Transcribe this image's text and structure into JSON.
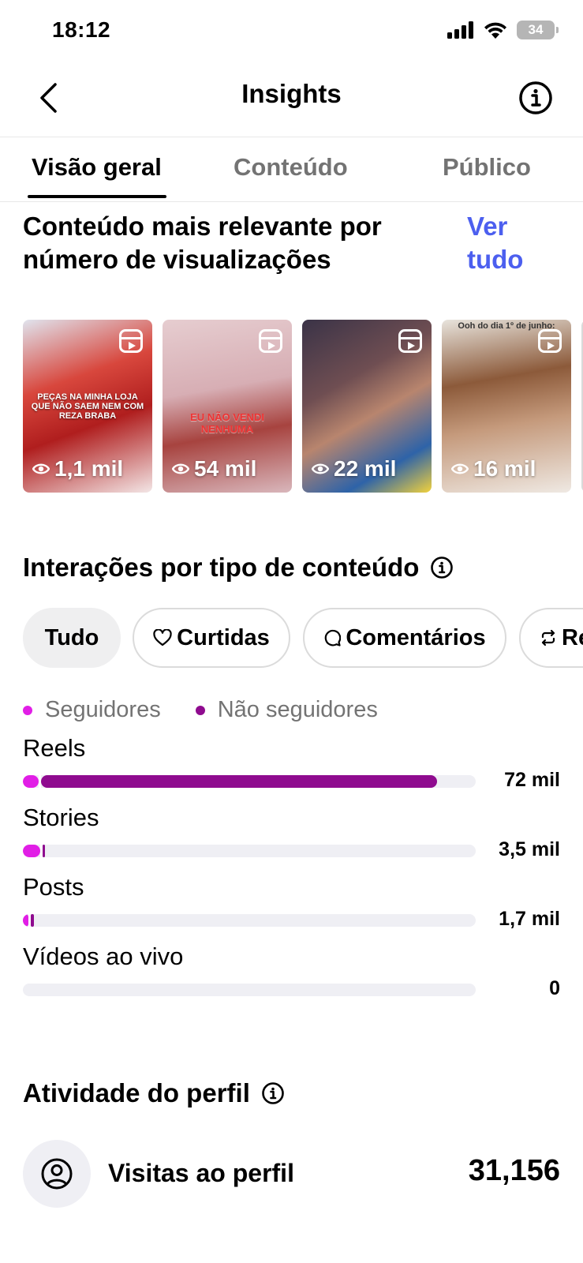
{
  "status_bar": {
    "time": "18:12",
    "battery": "34",
    "icons": [
      "signal-icon",
      "wifi-icon",
      "battery-icon"
    ]
  },
  "header": {
    "title": "Insights",
    "back_icon": "chevron-left-icon",
    "info_icon": "info-icon"
  },
  "tabs": [
    {
      "label": "Visão geral",
      "active": true
    },
    {
      "label": "Conteúdo",
      "active": false
    },
    {
      "label": "Público",
      "active": false
    }
  ],
  "top_content": {
    "title": "Conteúdo mais relevante por número de visualizações",
    "see_all": "Ver tudo",
    "items": [
      {
        "views": "1,1 mil",
        "overlay": "PEÇAS NA MINHA LOJA QUE NÃO SAEM NEM COM REZA BRABA",
        "type": "reel"
      },
      {
        "views": "54 mil",
        "overlay": "EU NÃO VENDI NENHUMA",
        "type": "reel"
      },
      {
        "views": "22 mil",
        "overlay": "",
        "type": "reel"
      },
      {
        "views": "16 mil",
        "overlay": "Ooh do dia 1º de junho:",
        "type": "reel"
      }
    ]
  },
  "interactions": {
    "title": "Interações por tipo de conteúdo",
    "filters": [
      {
        "label": "Tudo",
        "active": true,
        "icon": ""
      },
      {
        "label": "Curtidas",
        "active": false,
        "icon": "heart-icon"
      },
      {
        "label": "Comentários",
        "active": false,
        "icon": "comment-icon"
      },
      {
        "label": "Re",
        "active": false,
        "icon": "repost-icon"
      }
    ],
    "legend": [
      {
        "label": "Seguidores",
        "color": "#e11ee6"
      },
      {
        "label": "Não seguidores",
        "color": "#8f0b8f"
      }
    ],
    "rows": [
      {
        "label": "Reels",
        "value": "72 mil",
        "followers_fraction": 0.035,
        "nonfollowers_fraction": 0.875
      },
      {
        "label": "Stories",
        "value": "3,5 mil",
        "followers_fraction": 0.038,
        "nonfollowers_fraction": 0.004
      },
      {
        "label": "Posts",
        "value": "1,7 mil",
        "followers_fraction": 0.012,
        "nonfollowers_fraction": 0.008
      },
      {
        "label": "Vídeos ao vivo",
        "value": "0",
        "followers_fraction": 0,
        "nonfollowers_fraction": 0
      }
    ]
  },
  "profile_activity": {
    "title": "Atividade do perfil",
    "visits_label": "Visitas ao perfil",
    "visits_value": "31,156",
    "icon": "profile-icon"
  }
}
